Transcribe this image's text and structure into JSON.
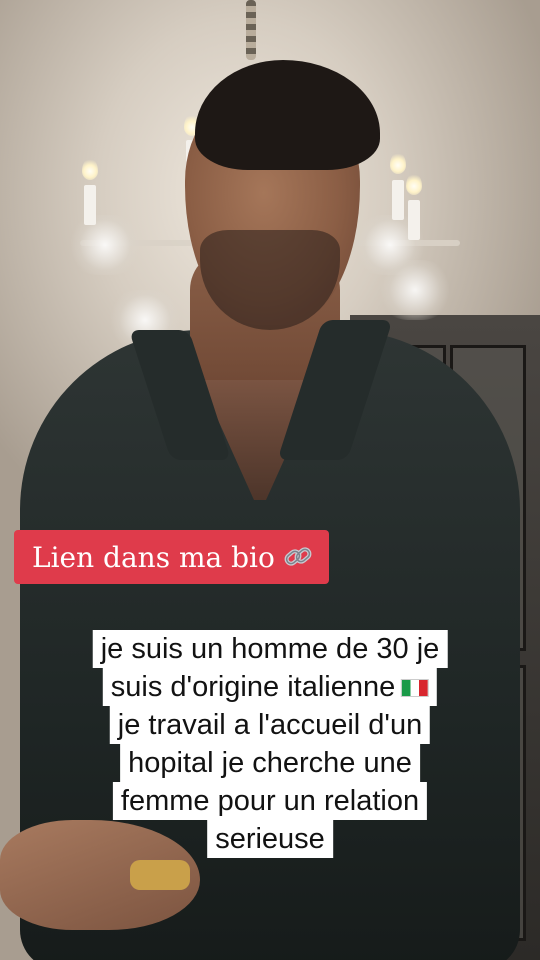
{
  "link_banner": {
    "text": "Lien dans ma bio",
    "icon": "link-icon",
    "color": "#df3b4b"
  },
  "caption": {
    "lines": [
      "je suis un homme de 30 je",
      "suis d'origine italienne",
      "je travail a l'accueil d'un",
      "hopital  je cherche une",
      "femme pour un relation",
      "serieuse"
    ],
    "flag_icon": "italy-flag-icon"
  }
}
